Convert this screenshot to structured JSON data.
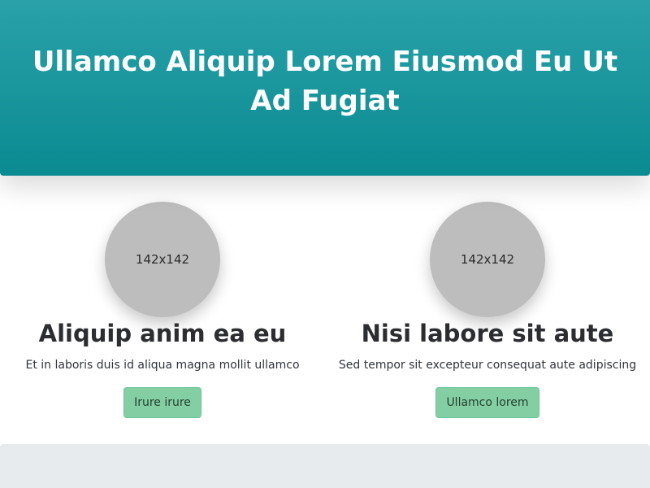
{
  "hero": {
    "title": "Ullamco Aliquip Lorem Eiusmod Eu Ut Ad Fugiat"
  },
  "cards": [
    {
      "image_label": "142x142",
      "title": "Aliquip anim ea eu",
      "text": "Et in laboris duis id aliqua magna mollit ullamco",
      "button_label": "Irure irure"
    },
    {
      "image_label": "142x142",
      "title": "Nisi labore sit aute",
      "text": "Sed tempor sit excepteur consequat aute adipiscing",
      "button_label": "Ullamco lorem"
    }
  ],
  "colors": {
    "hero_top": "#2aa1a9",
    "hero_bottom": "#0a8b91",
    "button": "#83cfa3",
    "avatar": "#bdbdbd",
    "bottom_band": "#e8ebee"
  }
}
